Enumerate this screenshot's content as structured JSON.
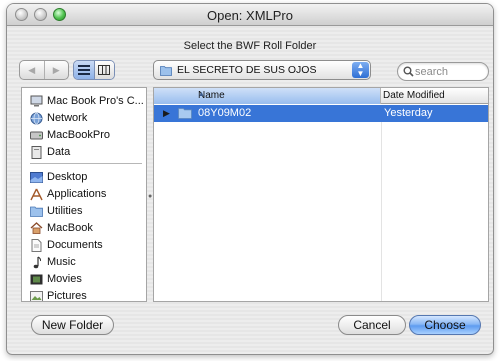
{
  "window": {
    "title": "Open: XMLPro"
  },
  "prompt": "Select the BWF Roll Folder",
  "toolbar": {
    "back_icon": "back-arrow-icon",
    "forward_icon": "forward-arrow-icon",
    "view_modes": [
      "list-view-icon",
      "column-view-icon"
    ],
    "location": "EL SECRETO DE SUS OJOS",
    "search_placeholder": "search"
  },
  "sidebar": {
    "devices": [
      {
        "label": "Mac Book Pro's C...",
        "icon": "computer-icon"
      },
      {
        "label": "Network",
        "icon": "network-globe-icon"
      },
      {
        "label": "MacBookPro",
        "icon": "hard-drive-icon"
      },
      {
        "label": "Data",
        "icon": "drive-icon"
      }
    ],
    "places": [
      {
        "label": "Desktop",
        "icon": "desktop-icon"
      },
      {
        "label": "Applications",
        "icon": "applications-icon"
      },
      {
        "label": "Utilities",
        "icon": "utilities-folder-icon"
      },
      {
        "label": "MacBook",
        "icon": "home-icon"
      },
      {
        "label": "Documents",
        "icon": "documents-icon"
      },
      {
        "label": "Music",
        "icon": "music-icon"
      },
      {
        "label": "Movies",
        "icon": "movies-icon"
      },
      {
        "label": "Pictures",
        "icon": "pictures-icon"
      }
    ]
  },
  "browser": {
    "columns": [
      "Name",
      "Date Modified"
    ],
    "rows": [
      {
        "name": "08Y09M02",
        "date": "Yesterday",
        "selected": true
      }
    ]
  },
  "buttons": {
    "new_folder": "New Folder",
    "cancel": "Cancel",
    "choose": "Choose"
  },
  "colors": {
    "selection": "#3875d7",
    "default_button": "#5e9cf0"
  }
}
